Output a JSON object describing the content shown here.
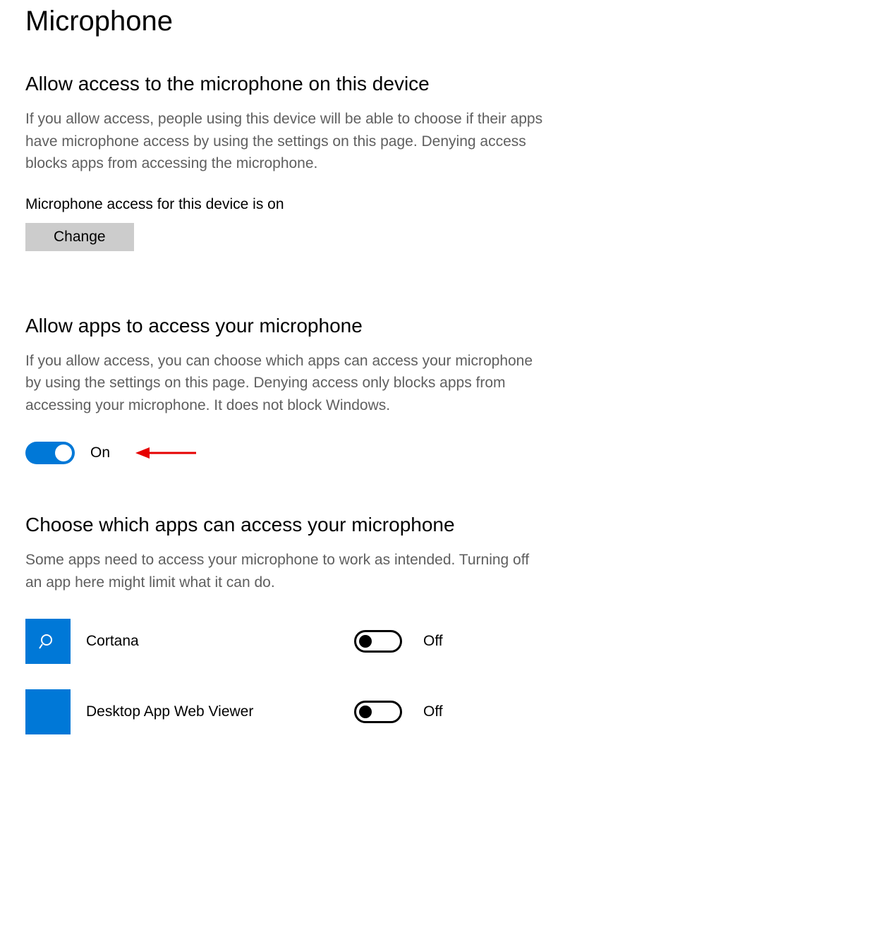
{
  "page": {
    "title": "Microphone"
  },
  "section1": {
    "heading": "Allow access to the microphone on this device",
    "desc": "If you allow access, people using this device will be able to choose if their apps have microphone access by using the settings on this page. Denying access blocks apps from accessing the microphone.",
    "status": "Microphone access for this device is on",
    "change_label": "Change"
  },
  "section2": {
    "heading": "Allow apps to access your microphone",
    "desc": "If you allow access, you can choose which apps can access your microphone by using the settings on this page. Denying access only blocks apps from accessing your microphone. It does not block Windows.",
    "toggle_state": "On"
  },
  "section3": {
    "heading": "Choose which apps can access your microphone",
    "desc": "Some apps need to access your microphone to work as intended. Turning off an app here might limit what it can do.",
    "apps": [
      {
        "name": "Cortana",
        "state": "Off",
        "icon": "search"
      },
      {
        "name": "Desktop App Web Viewer",
        "state": "Off",
        "icon": "blank"
      }
    ]
  },
  "annotation": {
    "arrow_color": "#e60000"
  }
}
